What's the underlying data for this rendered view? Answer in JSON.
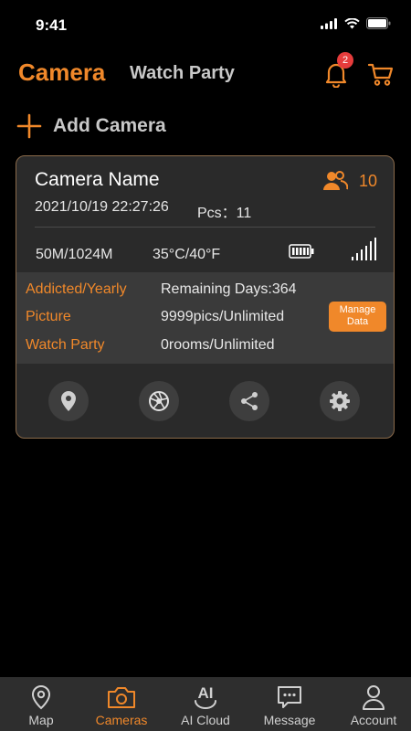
{
  "status_bar": {
    "time": "9:41"
  },
  "header": {
    "active_tab": "Camera",
    "other_tab": "Watch Party",
    "notification_count": "2"
  },
  "add_camera": {
    "label": "Add Camera"
  },
  "camera": {
    "name": "Camera Name",
    "viewers": "10",
    "datetime": "2021/10/19 22:27:26",
    "pcs": "Pcs：11",
    "storage": "50M/1024M",
    "temperature": "35°C/40°F",
    "info_rows": [
      {
        "label": "Addicted/Yearly",
        "value": "Remaining Days:364"
      },
      {
        "label": "Picture",
        "value": "9999pics/Unlimited"
      },
      {
        "label": "Watch Party",
        "value": "0rooms/Unlimited"
      }
    ],
    "manage_button": "Manage Data",
    "actions": [
      "location-icon",
      "aperture-icon",
      "share-icon",
      "settings-icon"
    ]
  },
  "bottom_nav": {
    "items": [
      {
        "label": "Map",
        "icon": "map-pin-icon"
      },
      {
        "label": "Cameras",
        "icon": "camera-icon"
      },
      {
        "label": "AI Cloud",
        "icon": "ai-cloud-icon",
        "icon_text": "AI"
      },
      {
        "label": "Message",
        "icon": "message-icon"
      },
      {
        "label": "Account",
        "icon": "account-icon"
      }
    ],
    "active_index": 1
  },
  "colors": {
    "accent": "#f0882a",
    "background": "#000000",
    "card": "#2a2a2a",
    "card_border": "#8a6a4a",
    "badge": "#e63c3c",
    "nav_background": "#2e2e2e"
  }
}
